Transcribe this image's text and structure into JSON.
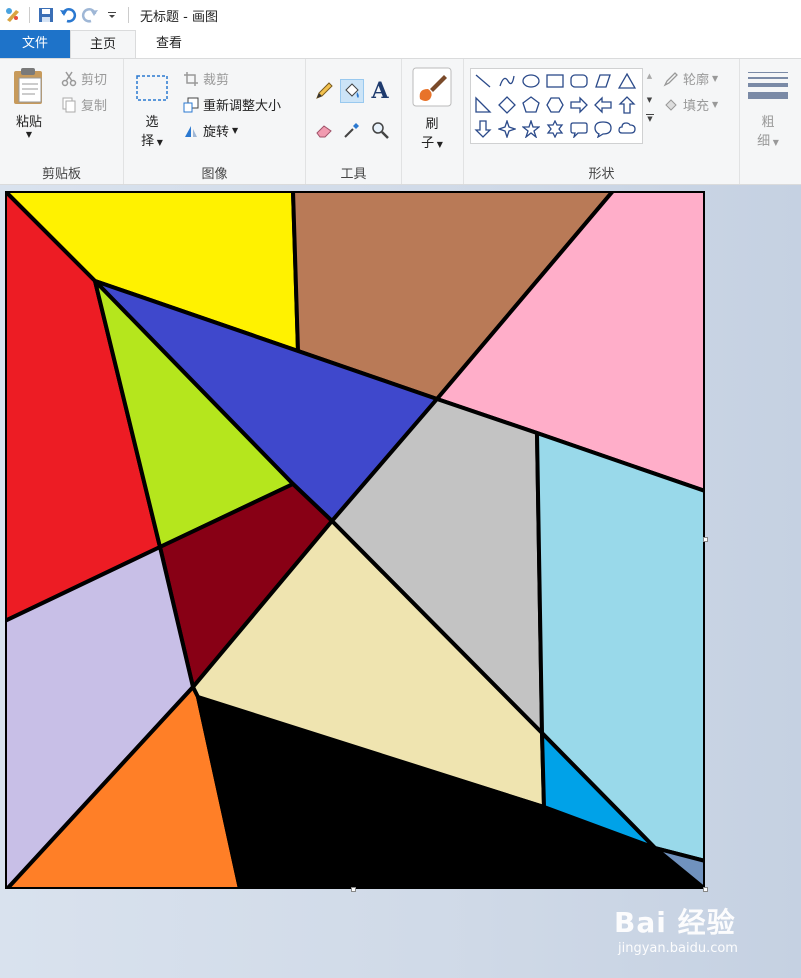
{
  "window": {
    "title": "无标题 - 画图"
  },
  "tabs": {
    "file": "文件",
    "home": "主页",
    "view": "查看"
  },
  "clipboard": {
    "paste": "粘贴",
    "cut": "剪切",
    "copy": "复制",
    "group_label": "剪贴板"
  },
  "image": {
    "select_line1": "选",
    "select_line2": "择",
    "crop": "裁剪",
    "resize": "重新调整大小",
    "rotate": "旋转",
    "group_label": "图像"
  },
  "tools": {
    "group_label": "工具"
  },
  "brush": {
    "line1": "刷",
    "line2": "子"
  },
  "shapes": {
    "outline": "轮廓",
    "fill": "填充",
    "group_label": "形状"
  },
  "size": {
    "line1": "粗",
    "line2": "细"
  },
  "watermark": {
    "main": "Bai 经验",
    "sub": "jingyan.baidu.com"
  },
  "colors": {
    "yellow": "#FFF200",
    "brown": "#B97A57",
    "pink": "#FFAEC9",
    "red": "#ED1C24",
    "blue": "#3F48CC",
    "lime": "#B5E61D",
    "gray": "#C3C3C3",
    "skyblue": "#99D9EA",
    "darkred": "#880015",
    "cream": "#EFE4B0",
    "lavender": "#C8BFE7",
    "orange": "#FF7F27",
    "black": "#000000",
    "cyan": "#00A2E8",
    "steel": "#7092BE"
  }
}
